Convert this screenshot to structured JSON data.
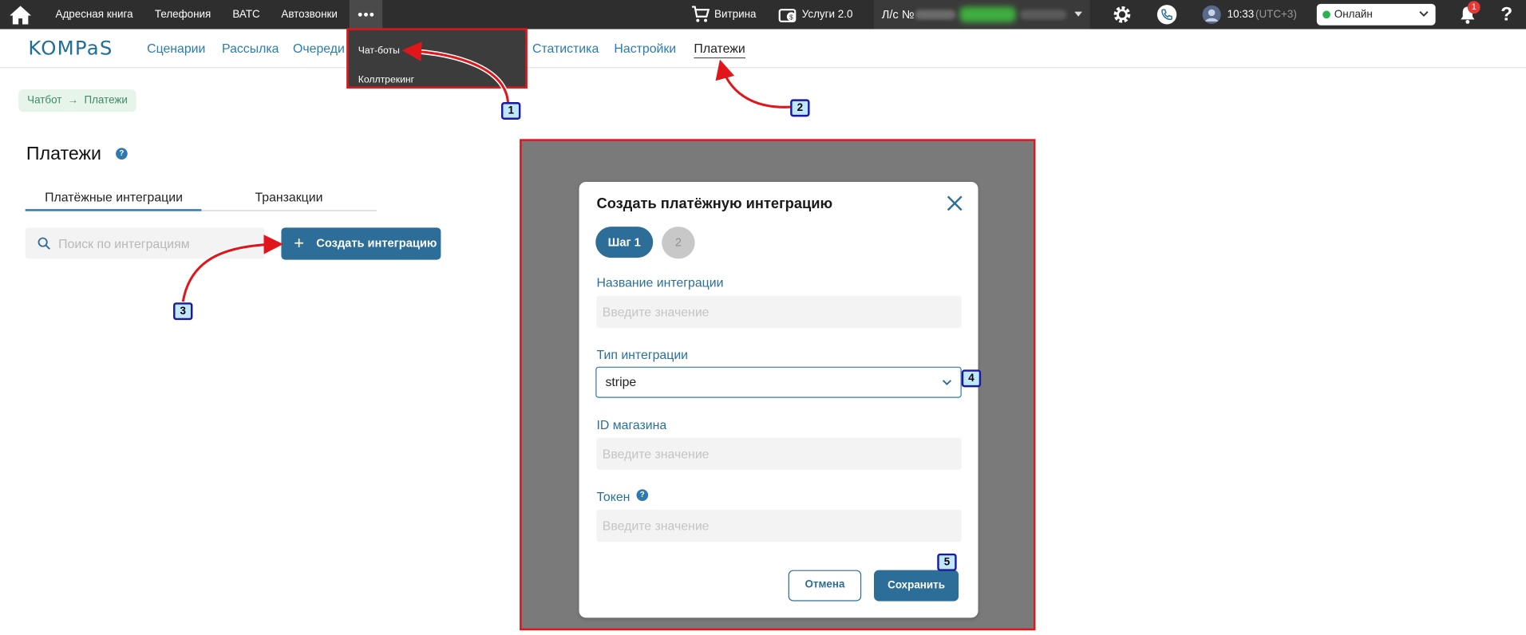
{
  "topbar": {
    "items": [
      "Адресная книга",
      "Телефония",
      "ВАТС",
      "Автозвонки"
    ],
    "showcase": "Витрина",
    "services": "Услуги 2.0",
    "account_label": "Л/с №",
    "time": "10:33",
    "timezone": "(UTC+3)",
    "status": "Онлайн",
    "notifications_count": "1"
  },
  "dropdown": {
    "items": [
      "Чат-боты",
      "Коллтрекинг"
    ]
  },
  "nav": {
    "logo": "KOMPaS",
    "items": [
      "Сценарии",
      "Рассылка",
      "Очереди",
      "Статистика",
      "Настройки",
      "Платежи"
    ],
    "active": "Платежи"
  },
  "breadcrumb": {
    "parent": "Чатбот",
    "arrow": "→",
    "current": "Платежи"
  },
  "page": {
    "title": "Платежи",
    "tabs": [
      "Платёжные интеграции",
      "Транзакции"
    ],
    "active_tab": "Платёжные интеграции",
    "search_placeholder": "Поиск по интеграциям",
    "create_button": "Создать интеграцию"
  },
  "modal": {
    "title": "Создать платёжную интеграцию",
    "steps": [
      "Шаг 1",
      "2"
    ],
    "fields": {
      "name": {
        "label": "Название интеграции",
        "placeholder": "Введите значение"
      },
      "type": {
        "label": "Тип интеграции",
        "value": "stripe"
      },
      "shop_id": {
        "label": "ID магазина",
        "placeholder": "Введите значение"
      },
      "token": {
        "label": "Токен",
        "placeholder": "Введите значение"
      }
    },
    "cancel": "Отмена",
    "save": "Сохранить"
  },
  "annotations": {
    "labels": [
      "1",
      "2",
      "3",
      "4",
      "5"
    ]
  },
  "colors": {
    "accent": "#2c6e98",
    "highlight": "#e0161b",
    "topbar": "#2e2e2e",
    "online": "#2bb24c"
  }
}
